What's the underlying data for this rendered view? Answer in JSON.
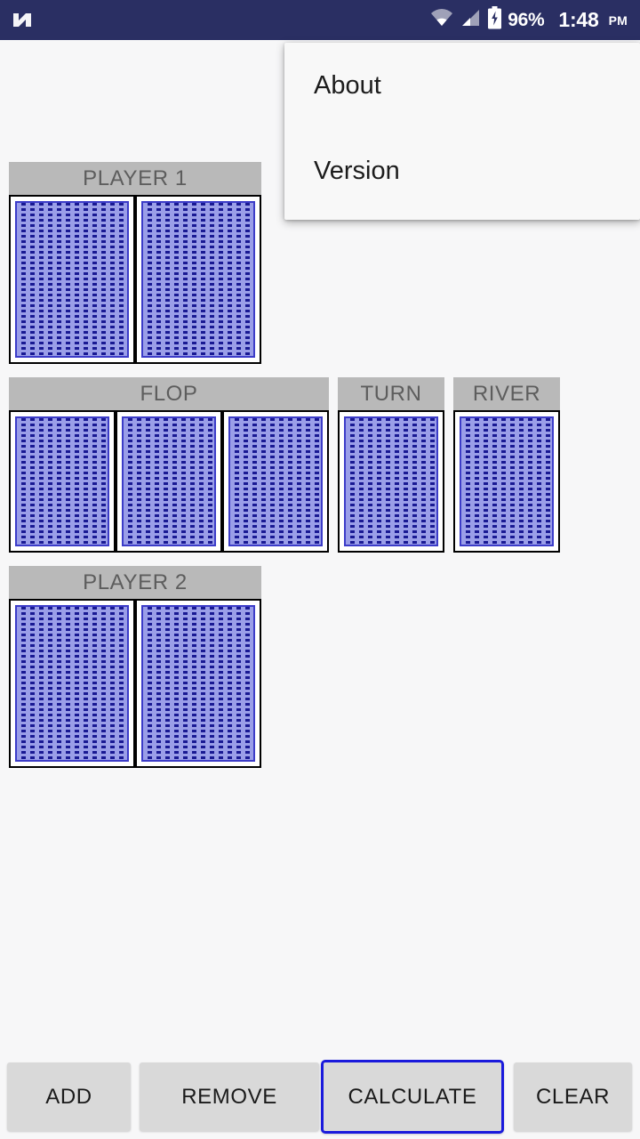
{
  "status_bar": {
    "logo_icon": "android-n-logo",
    "wifi_icon": "wifi-icon",
    "signal_icon": "cell-signal-icon",
    "battery_icon": "battery-charging-icon",
    "battery_percent": "96%",
    "time": "1:48",
    "am_pm": "PM",
    "background_color": "#2a2f63"
  },
  "menu": {
    "items": [
      {
        "label": "About"
      },
      {
        "label": "Version"
      }
    ]
  },
  "board": {
    "player1": {
      "header": "PLAYER 1",
      "cards": [
        {
          "face": "card-back"
        },
        {
          "face": "card-back"
        }
      ]
    },
    "flop": {
      "header": "FLOP",
      "cards": [
        {
          "face": "card-back"
        },
        {
          "face": "card-back"
        },
        {
          "face": "card-back"
        }
      ]
    },
    "turn": {
      "header": "TURN",
      "cards": [
        {
          "face": "card-back"
        }
      ]
    },
    "river": {
      "header": "RIVER",
      "cards": [
        {
          "face": "card-back"
        }
      ]
    },
    "player2": {
      "header": "PLAYER 2",
      "cards": [
        {
          "face": "card-back"
        },
        {
          "face": "card-back"
        }
      ]
    }
  },
  "buttons": {
    "add": "ADD",
    "remove": "REMOVE",
    "calculate": "CALCULATE",
    "clear": "CLEAR"
  },
  "colors": {
    "status_bar": "#2a2f63",
    "header_bar": "#b9b9b9",
    "header_text": "#5d5d5d",
    "card_navy": "#191993",
    "card_pattern": "#9a9ee8",
    "button_face": "#d9d9d9",
    "focus_border": "#1a1adc",
    "page_background": "#f7f7f8"
  }
}
